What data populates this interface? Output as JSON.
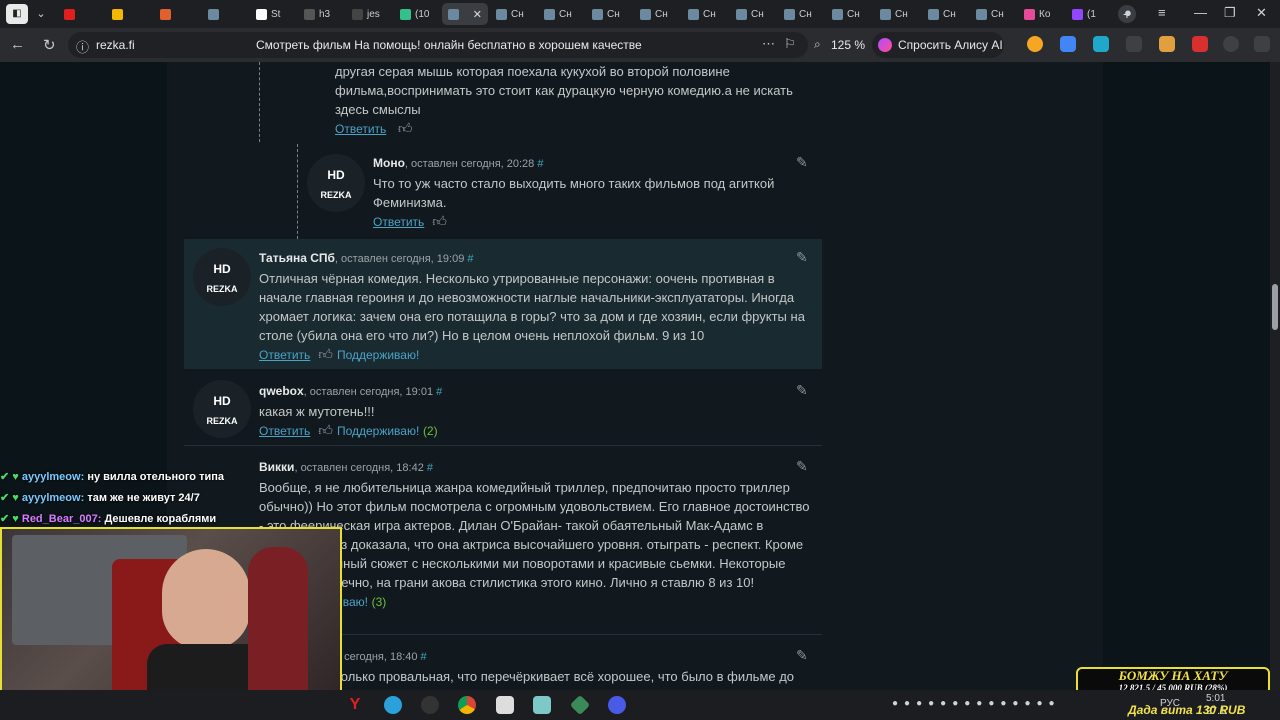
{
  "browser": {
    "tabs": [
      {
        "label": "",
        "color": "#e02020"
      },
      {
        "label": "",
        "color": "#f5b800"
      },
      {
        "label": "",
        "color": "#e06030"
      },
      {
        "label": "",
        "color": "#6b8aa0"
      },
      {
        "label": "St",
        "color": "#ffffff"
      },
      {
        "label": "h3",
        "color": "#555555"
      },
      {
        "label": "jes",
        "color": "#444444"
      },
      {
        "label": "(10",
        "color": "#34c08a"
      },
      {
        "label": "",
        "color": "#6b8aa0",
        "active": true
      },
      {
        "label": "Сн",
        "color": "#6b8aa0"
      },
      {
        "label": "Сн",
        "color": "#6b8aa0"
      },
      {
        "label": "Сн",
        "color": "#6b8aa0"
      },
      {
        "label": "Сн",
        "color": "#6b8aa0"
      },
      {
        "label": "Сн",
        "color": "#6b8aa0"
      },
      {
        "label": "Сн",
        "color": "#6b8aa0"
      },
      {
        "label": "Сн",
        "color": "#6b8aa0"
      },
      {
        "label": "Сн",
        "color": "#6b8aa0"
      },
      {
        "label": "Сн",
        "color": "#6b8aa0"
      },
      {
        "label": "Сн",
        "color": "#6b8aa0"
      },
      {
        "label": "Сн",
        "color": "#6b8aa0"
      },
      {
        "label": "Ко",
        "color": "#e84a9a"
      },
      {
        "label": "(1",
        "color": "#9146ff"
      }
    ],
    "url": "rezka.fi",
    "page_title": "Смотреть фильм На помощь! онлайн бесплатно в хорошем качестве",
    "zoom": "125 %",
    "alice_label": "Спросить Алису AI"
  },
  "comments": [
    {
      "id": "top",
      "text": "другая серая мышь которая поехала кукухой во второй половине фильма,воспринимать это стоит как дурацкую черную комедию.а не искать здесь смыслы",
      "reply": "Ответить"
    },
    {
      "id": "mono",
      "author": "Моно",
      "meta": "оставлен сегодня, 20:28",
      "text": "Что то уж часто стало выходить много таких фильмов под агиткой Феминизма.",
      "reply": "Ответить"
    },
    {
      "id": "tatiana",
      "author": "Татьяна СПб",
      "meta": "оставлен сегодня, 19:09",
      "text": "Отличная чёрная комедия. Несколько утрированные персонажи: оочень противная в начале главная героиня и до невозможности наглые начальники-эксплуататоры. Иногда хромает логика: зачем она его потащила в горы? что за дом и где хозяин, если фрукты на столе (убила она его что ли?) Но в целом очень неплохой фильм. 9 из 10",
      "reply": "Ответить",
      "support": "Поддерживаю!"
    },
    {
      "id": "qwebox",
      "author": "qwebox",
      "meta": "оставлен сегодня, 19:01",
      "text": "какая ж мутотень!!!",
      "reply": "Ответить",
      "support": "Поддерживаю!",
      "count": "(2)"
    },
    {
      "id": "vikki",
      "author": "Викки",
      "meta": "оставлен сегодня, 18:42",
      "text": "Вообще, я не любительница жанра комедийный триллер, предпочитаю просто триллер обычно)) Но этот фильм посмотрела с огромным удовольствием. Его главное достоинство - это феерическая игра актеров. Дилан О'Брайан- такой обаятельный Мак-Адамс в очередной раз доказала, что она актриса высочайшего уровня. отыграть - респект. Кроме того, динамичный сюжет с несколькими ми поворотами и красивые сьемки. Некоторые моменты, конечно, на грани акова стилистика этого кино. Лично я ставлю 8 из 10!",
      "support": "Поддерживаю!",
      "count": "(3)"
    },
    {
      "id": "last",
      "meta": "н сегодня, 18:40",
      "text": "только провальная, что перечёркивает всё хорошее, что было в фильме до"
    }
  ],
  "avatar": {
    "hd": "HD",
    "rezka": "REZKA"
  },
  "chat": [
    {
      "user": "ayyylmeow:",
      "msg": "ну вилла отельного типа"
    },
    {
      "user": "ayyylmeow:",
      "msg": "там же не живут 24/7"
    },
    {
      "user": "Red_Bear_007:",
      "msg": "Дешевле кораблями"
    }
  ],
  "banner": {
    "title": "БОМЖУ НА ХАТУ",
    "progress": "12 821,5 / 45 000 RUB (28%)",
    "ticker": "Дада вита 130 RUB"
  },
  "taskbar": {
    "lang": "РУС",
    "time": "5:01",
    "date": "27.1"
  }
}
